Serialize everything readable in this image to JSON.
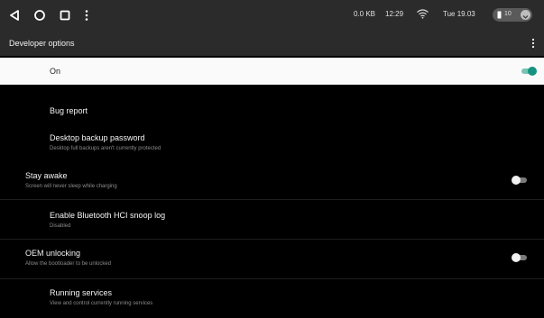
{
  "status_bar": {
    "nav_icons": [
      "back-triangle-icon",
      "home-circle-icon",
      "recents-square-icon",
      "more-vertical-icon"
    ],
    "data_speed": "0.0 KB",
    "time": "12:29",
    "date": "Tue 19.03",
    "battery_level": "10",
    "wifi_icon": "wifi-icon"
  },
  "toolbar": {
    "title": "Developer options",
    "overflow_icon": "more-vertical-icon"
  },
  "master_switch": {
    "label": "On",
    "enabled": true
  },
  "settings": [
    {
      "title": "Bug report",
      "subtitle": ""
    },
    {
      "title": "Desktop backup password",
      "subtitle": "Desktop full backups aren't currently protected"
    },
    {
      "title": "Stay awake",
      "subtitle": "Screen will never sleep while charging",
      "toggle": false
    },
    {
      "title": "Enable Bluetooth HCI snoop log",
      "subtitle": "Disabled"
    },
    {
      "title": "OEM unlocking",
      "subtitle": "Allow the bootloader to be unlocked",
      "toggle": false
    },
    {
      "title": "Running services",
      "subtitle": "View and control currently running services"
    }
  ],
  "colors": {
    "accent": "#15937f",
    "bar_bg": "#2b2b2b",
    "list_bg": "#000000"
  }
}
